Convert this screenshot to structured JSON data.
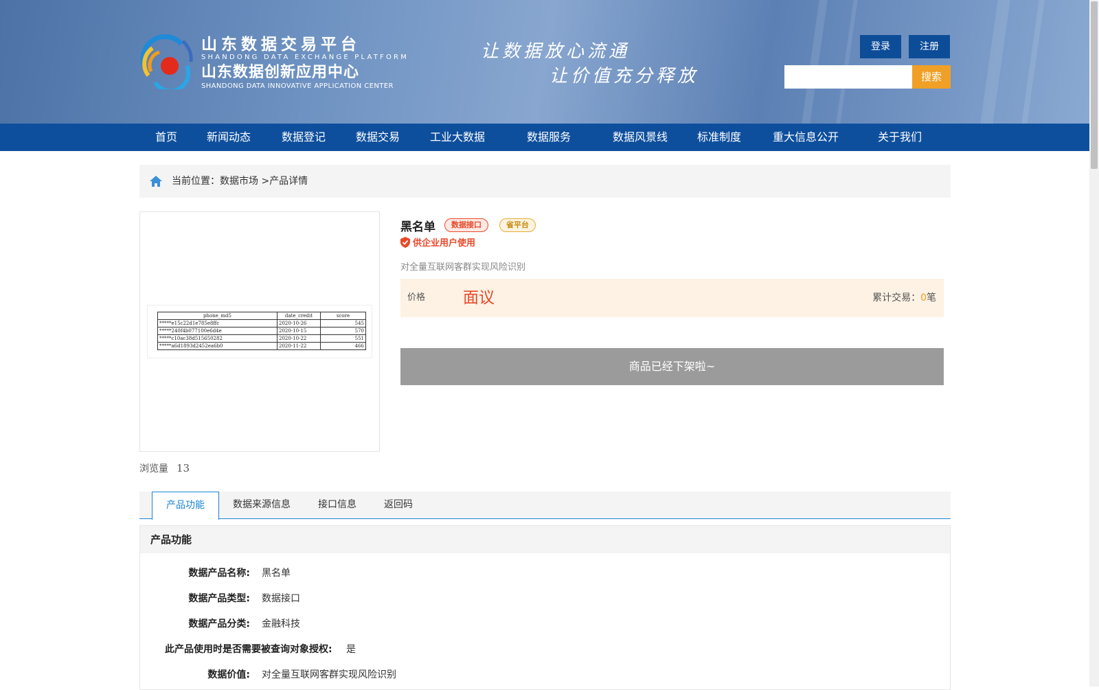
{
  "header": {
    "logo": {
      "title_cn": "山东数据交易平台",
      "title_en": "SHANDONG DATA EXCHANGE PLATFORM",
      "subtitle_cn": "山东数据创新应用中心",
      "subtitle_en": "SHANDONG DATA INNOVATIVE APPLICATION CENTER"
    },
    "slogan_line1": "让数据放心流通",
    "slogan_line2": "让价值充分释放",
    "login_label": "登录",
    "register_label": "注册",
    "search": {
      "value": "",
      "button_label": "搜索"
    }
  },
  "nav": {
    "items": [
      {
        "label": "首页"
      },
      {
        "label": "新闻动态"
      },
      {
        "label": "数据登记"
      },
      {
        "label": "数据交易"
      },
      {
        "label": "工业大数据"
      },
      {
        "label": "数据服务"
      },
      {
        "label": "数据风景线"
      },
      {
        "label": "标准制度"
      },
      {
        "label": "重大信息公开"
      },
      {
        "label": "关于我们"
      }
    ]
  },
  "breadcrumb": {
    "prefix": "当前位置：",
    "path": [
      "数据市场",
      ">",
      "产品详情"
    ]
  },
  "product": {
    "name": "黑名单",
    "tags": [
      "数据接口",
      "省平台"
    ],
    "enterprise_note": "供企业用户使用",
    "description": "对全量互联网客群实现风险识别",
    "price_label": "价格",
    "price_value": "面议",
    "trade_label": "累计交易：",
    "trade_count": "0",
    "trade_unit": "笔",
    "offshelf_text": "商品已经下架啦~",
    "views_label": "浏览量",
    "views_count": "13",
    "sample_table": {
      "headers": [
        "phone_md5",
        "date_credit",
        "score"
      ],
      "rows": [
        [
          "*****e15c22d1e785e8ffc",
          "2020-10-26",
          "545"
        ],
        [
          "*****240f4b077100e6d4e",
          "2020-10-15",
          "570"
        ],
        [
          "*****c10ac38d515650282",
          "2020-10-22",
          "551"
        ],
        [
          "*****a6d1893d2452ea6b0",
          "2020-11-22",
          "466"
        ]
      ]
    }
  },
  "tabs": {
    "items": [
      {
        "label": "产品功能"
      },
      {
        "label": "数据来源信息"
      },
      {
        "label": "接口信息"
      },
      {
        "label": "返回码"
      }
    ],
    "active_index": 0
  },
  "panel": {
    "title": "产品功能",
    "rows": [
      {
        "label": "数据产品名称:",
        "value": "黑名单"
      },
      {
        "label": "数据产品类型:",
        "value": "数据接口"
      },
      {
        "label": "数据产品分类:",
        "value": "金融科技"
      },
      {
        "label": "此产品使用时是否需要被查询对象授权:",
        "value": "是"
      },
      {
        "label": "数据价值:",
        "value": "对全量互联网客群实现风险识别"
      }
    ]
  },
  "colors": {
    "nav_bg": "#0e4f9d",
    "accent_orange": "#f0a026",
    "accent_red": "#e8492b",
    "tab_blue": "#1c85d0"
  }
}
